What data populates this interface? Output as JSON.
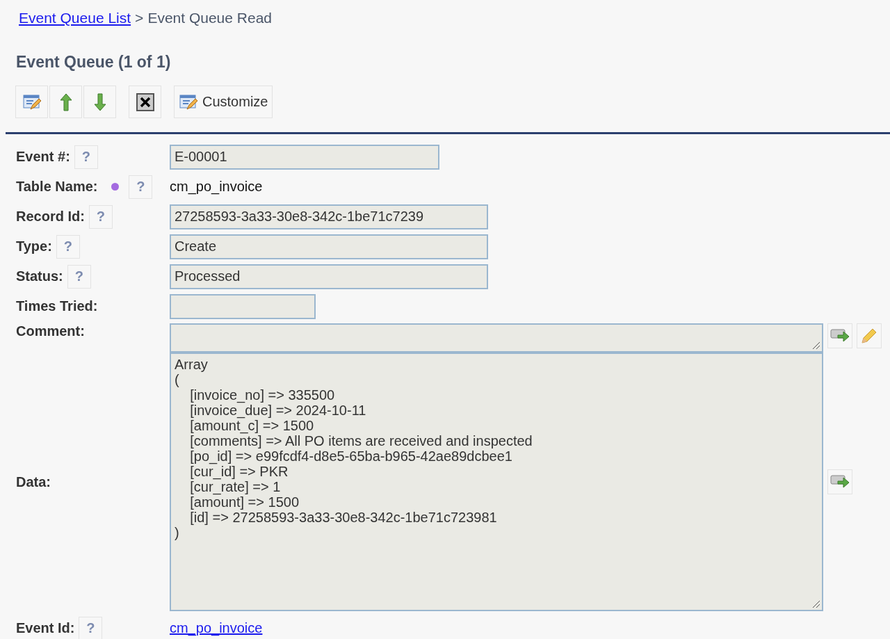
{
  "breadcrumb": {
    "link": "Event Queue List",
    "separator": ">",
    "current": "Event Queue Read"
  },
  "title": "Event Queue (1 of 1)",
  "toolbar": [
    {
      "kind": "edit"
    },
    {
      "kind": "up"
    },
    {
      "kind": "down"
    },
    {
      "kind": "delete"
    },
    {
      "kind": "customize",
      "label": "Customize"
    }
  ],
  "fields": [
    {
      "kind": "mediuminput",
      "label": "Event #:",
      "help": "?",
      "value": "E-00001"
    },
    {
      "kind": "text",
      "label": "Table Name:",
      "help": "?",
      "color": "#a46be0",
      "value": "cm_po_invoice"
    },
    {
      "kind": "input",
      "label": "Record Id:",
      "help": "?",
      "value": "27258593-3a33-30e8-342c-1be71c7239"
    },
    {
      "kind": "input",
      "label": "Type:",
      "help": "?",
      "value": "Create"
    },
    {
      "kind": "input",
      "label": "Status:",
      "help": "?",
      "value": "Processed"
    },
    {
      "kind": "shortinput",
      "label": "Times Tried:"
    },
    {
      "kind": "comment",
      "label": "Comment:"
    },
    {
      "kind": "data",
      "label": "Data:",
      "value": "Array\n(\n    [invoice_no] => 335500\n    [invoice_due] => 2024-10-11\n    [amount_c] => 1500\n    [comments] => All PO items are received and inspected\n    [po_id] => e99fcdf4-d8e5-65ba-b965-42ae89dcbee1\n    [cur_id] => PKR\n    [cur_rate] => 1\n    [amount] => 1500\n    [id] => 27258593-3a33-30e8-342c-1be71c723981\n)"
    },
    {
      "kind": "link",
      "label": "Event Id:",
      "help": "?",
      "value": "cm_po_invoice"
    }
  ]
}
